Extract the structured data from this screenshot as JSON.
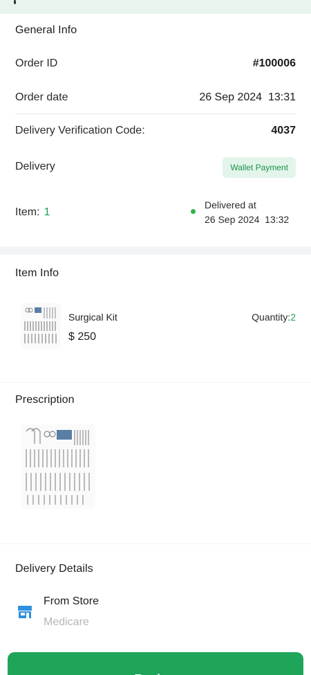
{
  "general": {
    "title": "General Info",
    "order_id_label": "Order ID",
    "order_id_value": "#100006",
    "order_date_label": "Order date",
    "order_date_value": "26 Sep 2024  13:31",
    "verification_label": "Delivery Verification Code:",
    "verification_value": "4037",
    "delivery_label": "Delivery",
    "payment_badge": "Wallet Payment",
    "item_label": "Item:",
    "item_count": "1",
    "delivered_label": "Delivered at",
    "delivered_value": "26 Sep 2024  13:32"
  },
  "item_info": {
    "title": "Item Info",
    "name": "Surgical Kit",
    "price": "$ 250",
    "quantity_label": "Quantity:",
    "quantity_value": "2"
  },
  "prescription": {
    "title": "Prescription"
  },
  "delivery_details": {
    "title": "Delivery Details",
    "store_label": "From Store",
    "store_name": "Medicare",
    "icon": "store-icon"
  },
  "actions": {
    "review_label": "Review"
  },
  "colors": {
    "accent": "#1fa55a",
    "badge_bg": "#e3f5ea",
    "status_dot": "#2fb34f",
    "store_icon": "#2f8fe0"
  }
}
